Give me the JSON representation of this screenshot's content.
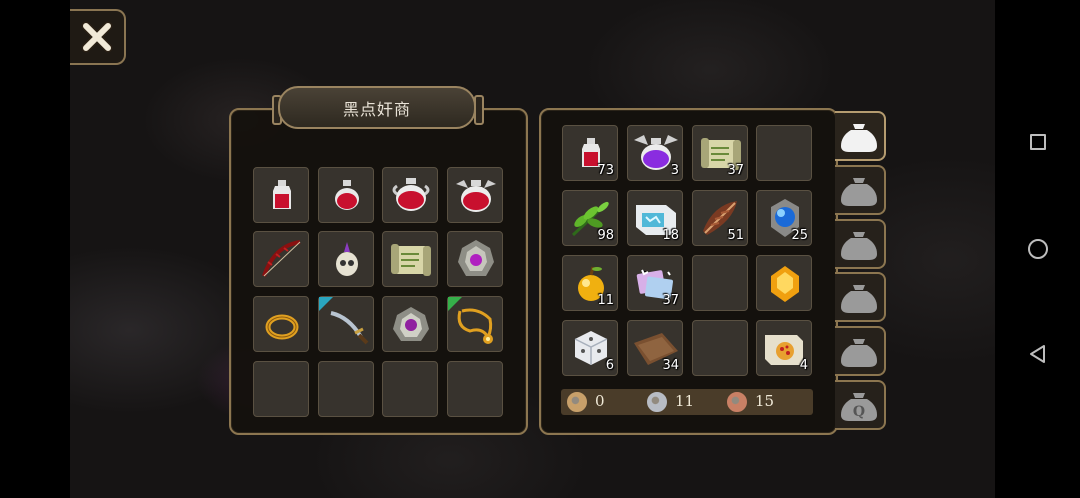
{
  "shop": {
    "title": "黑点奸商",
    "items": [
      {
        "icon": "small-red-potion-icon"
      },
      {
        "icon": "red-potion-icon"
      },
      {
        "icon": "large-red-potion-icon"
      },
      {
        "icon": "winged-red-potion-icon"
      },
      {
        "icon": "red-bow-icon"
      },
      {
        "icon": "skull-helmet-icon"
      },
      {
        "icon": "scroll-icon"
      },
      {
        "icon": "gem-shell-icon"
      },
      {
        "icon": "gold-ring-icon"
      },
      {
        "icon": "curved-sword-icon",
        "corner": "#2aa6c0"
      },
      {
        "icon": "gem-amulet-shell-icon"
      },
      {
        "icon": "gold-necklace-icon",
        "corner": "#35b04a"
      },
      {
        "icon": ""
      },
      {
        "icon": ""
      },
      {
        "icon": ""
      },
      {
        "icon": ""
      }
    ]
  },
  "inventory": {
    "items": [
      {
        "icon": "small-red-potion-icon",
        "count": "73"
      },
      {
        "icon": "winged-purple-potion-icon",
        "count": "3"
      },
      {
        "icon": "scroll-icon",
        "count": "37"
      },
      {
        "icon": "",
        "count": ""
      },
      {
        "icon": "green-herb-icon",
        "count": "98"
      },
      {
        "icon": "blue-map-icon",
        "count": "18"
      },
      {
        "icon": "brown-feather-icon",
        "count": "51"
      },
      {
        "icon": "blue-orb-icon",
        "count": "25"
      },
      {
        "icon": "golden-apple-icon",
        "count": "11"
      },
      {
        "icon": "magic-cards-icon",
        "count": "37"
      },
      {
        "icon": "",
        "count": ""
      },
      {
        "icon": "amber-gem-icon",
        "count": ""
      },
      {
        "icon": "white-dice-icon",
        "count": "6"
      },
      {
        "icon": "brown-cloth-icon",
        "count": "34"
      },
      {
        "icon": "",
        "count": ""
      },
      {
        "icon": "pizza-scroll-icon",
        "count": "4"
      }
    ],
    "currency": [
      {
        "icon": "gold-coin-icon",
        "amount": "0",
        "color": "#c8a06a"
      },
      {
        "icon": "silver-coin-icon",
        "amount": "11",
        "color": "#b8bcc4"
      },
      {
        "icon": "copper-coin-icon",
        "amount": "15",
        "color": "#c98065"
      }
    ]
  },
  "tabs": [
    {
      "icon": "bag-icon",
      "active": true
    },
    {
      "icon": "bag-icon",
      "active": false
    },
    {
      "icon": "bag-icon",
      "active": false
    },
    {
      "icon": "bag-icon",
      "active": false
    },
    {
      "icon": "bag-icon",
      "active": false
    },
    {
      "icon": "quest-bag-icon",
      "active": false,
      "letter": "Q"
    }
  ],
  "colors": {
    "frame": "#8c7650",
    "slot": "#37332d",
    "accent_bag": "#d8d8d8"
  }
}
